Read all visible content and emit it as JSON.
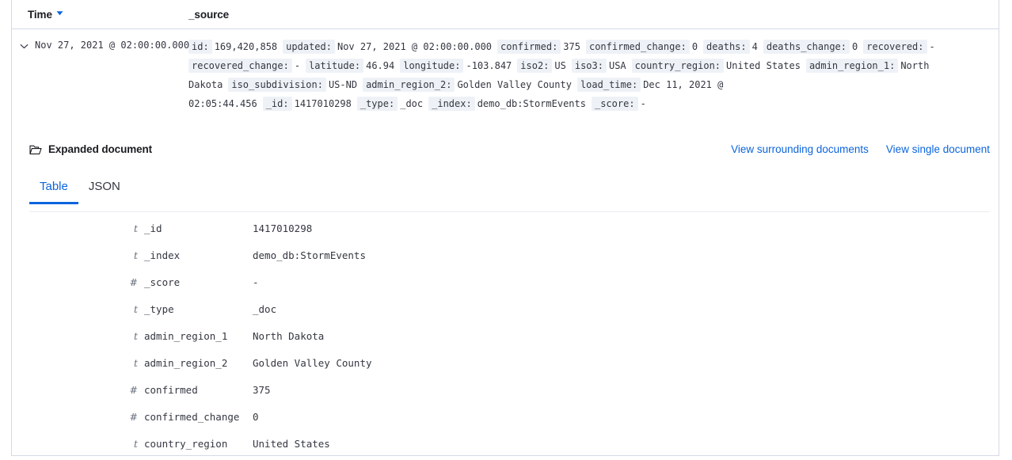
{
  "table": {
    "columns": [
      {
        "label": "Time",
        "sort_icon": "sort-descending-triangle-icon"
      },
      {
        "label": "_source"
      }
    ],
    "row": {
      "expand_icon": "chevron-down-icon",
      "time": "Nov 27, 2021 @ 02:00:00.000",
      "source_pairs": [
        {
          "key": "id:",
          "value": "169,420,858"
        },
        {
          "key": "updated:",
          "value": "Nov 27, 2021 @ 02:00:00.000"
        },
        {
          "key": "confirmed:",
          "value": "375"
        },
        {
          "key": "confirmed_change:",
          "value": "0"
        },
        {
          "key": "deaths:",
          "value": "4"
        },
        {
          "key": "deaths_change:",
          "value": "0"
        },
        {
          "key": "recovered:",
          "value": "-"
        },
        {
          "key": "recovered_change:",
          "value": "-"
        },
        {
          "key": "latitude:",
          "value": "46.94"
        },
        {
          "key": "longitude:",
          "value": "-103.847"
        },
        {
          "key": "iso2:",
          "value": "US"
        },
        {
          "key": "iso3:",
          "value": "USA"
        },
        {
          "key": "country_region:",
          "value": "United States"
        },
        {
          "key": "admin_region_1:",
          "value": "North Dakota"
        },
        {
          "key": "iso_subdivision:",
          "value": "US-ND"
        },
        {
          "key": "admin_region_2:",
          "value": "Golden Valley County"
        },
        {
          "key": "load_time:",
          "value": "Dec 11, 2021 @ 02:05:44.456"
        },
        {
          "key": "_id:",
          "value": "1417010298"
        },
        {
          "key": "_type:",
          "value": "_doc"
        },
        {
          "key": "_index:",
          "value": "demo_db:StormEvents"
        },
        {
          "key": "_score:",
          "value": "-"
        }
      ]
    }
  },
  "expanded_document": {
    "icon": "folder-open-icon",
    "title": "Expanded document",
    "links": [
      {
        "label": "View surrounding documents"
      },
      {
        "label": "View single document"
      }
    ],
    "tabs": [
      {
        "label": "Table",
        "active": true
      },
      {
        "label": "JSON",
        "active": false
      }
    ],
    "fields": [
      {
        "type": "t",
        "name": "_id",
        "value": "1417010298"
      },
      {
        "type": "t",
        "name": "_index",
        "value": "demo_db:StormEvents"
      },
      {
        "type": "#",
        "name": "_score",
        "value": "-"
      },
      {
        "type": "t",
        "name": "_type",
        "value": "_doc"
      },
      {
        "type": "t",
        "name": "admin_region_1",
        "value": "North Dakota"
      },
      {
        "type": "t",
        "name": "admin_region_2",
        "value": "Golden Valley County"
      },
      {
        "type": "#",
        "name": "confirmed",
        "value": "375"
      },
      {
        "type": "#",
        "name": "confirmed_change",
        "value": "0"
      },
      {
        "type": "t",
        "name": "country_region",
        "value": "United States"
      }
    ]
  },
  "colors": {
    "link": "#0b64dd",
    "accent": "#0b64dd",
    "border": "#d3dae6",
    "key_badge_bg": "#eef2f7",
    "text": "#343741",
    "muted": "#69707d"
  }
}
